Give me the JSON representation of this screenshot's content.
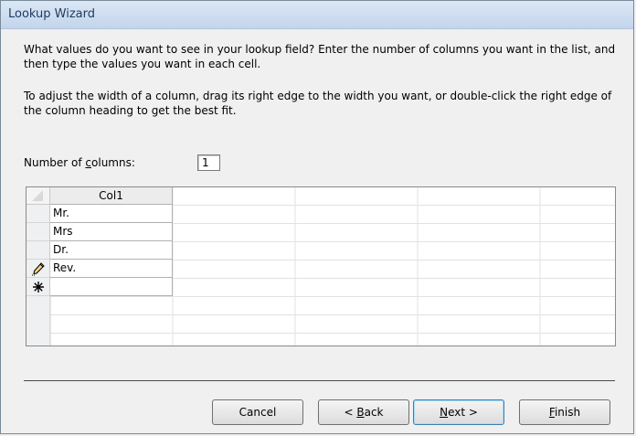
{
  "window": {
    "title": "Lookup Wizard"
  },
  "instructions": {
    "line1": "What values do you want to see in your lookup field? Enter the number of columns you want in the list, and then type the values you want in each cell.",
    "line2": "To adjust the width of a column, drag its right edge to the width you want, or double-click the right edge of the column heading to get the best fit."
  },
  "number_of_columns": {
    "label_before": "Number of ",
    "label_underlined": "c",
    "label_after": "olumns:",
    "value": "1"
  },
  "grid": {
    "column_header": "Col1",
    "rows": [
      {
        "selector": "",
        "value": "Mr."
      },
      {
        "selector": "",
        "value": "Mrs"
      },
      {
        "selector": "",
        "value": "Dr."
      },
      {
        "selector": "pencil-icon",
        "value": "Rev."
      },
      {
        "selector": "new-record-icon",
        "value": ""
      }
    ]
  },
  "buttons": {
    "cancel": {
      "label": "Cancel"
    },
    "back": {
      "before": "< ",
      "underlined": "B",
      "after": "ack"
    },
    "next": {
      "underlined": "N",
      "after": "ext >"
    },
    "finish": {
      "underlined": "F",
      "after": "inish"
    }
  },
  "colors": {
    "title_gradient_top": "#dbe7f5",
    "default_button_border": "#3c7fb1"
  }
}
